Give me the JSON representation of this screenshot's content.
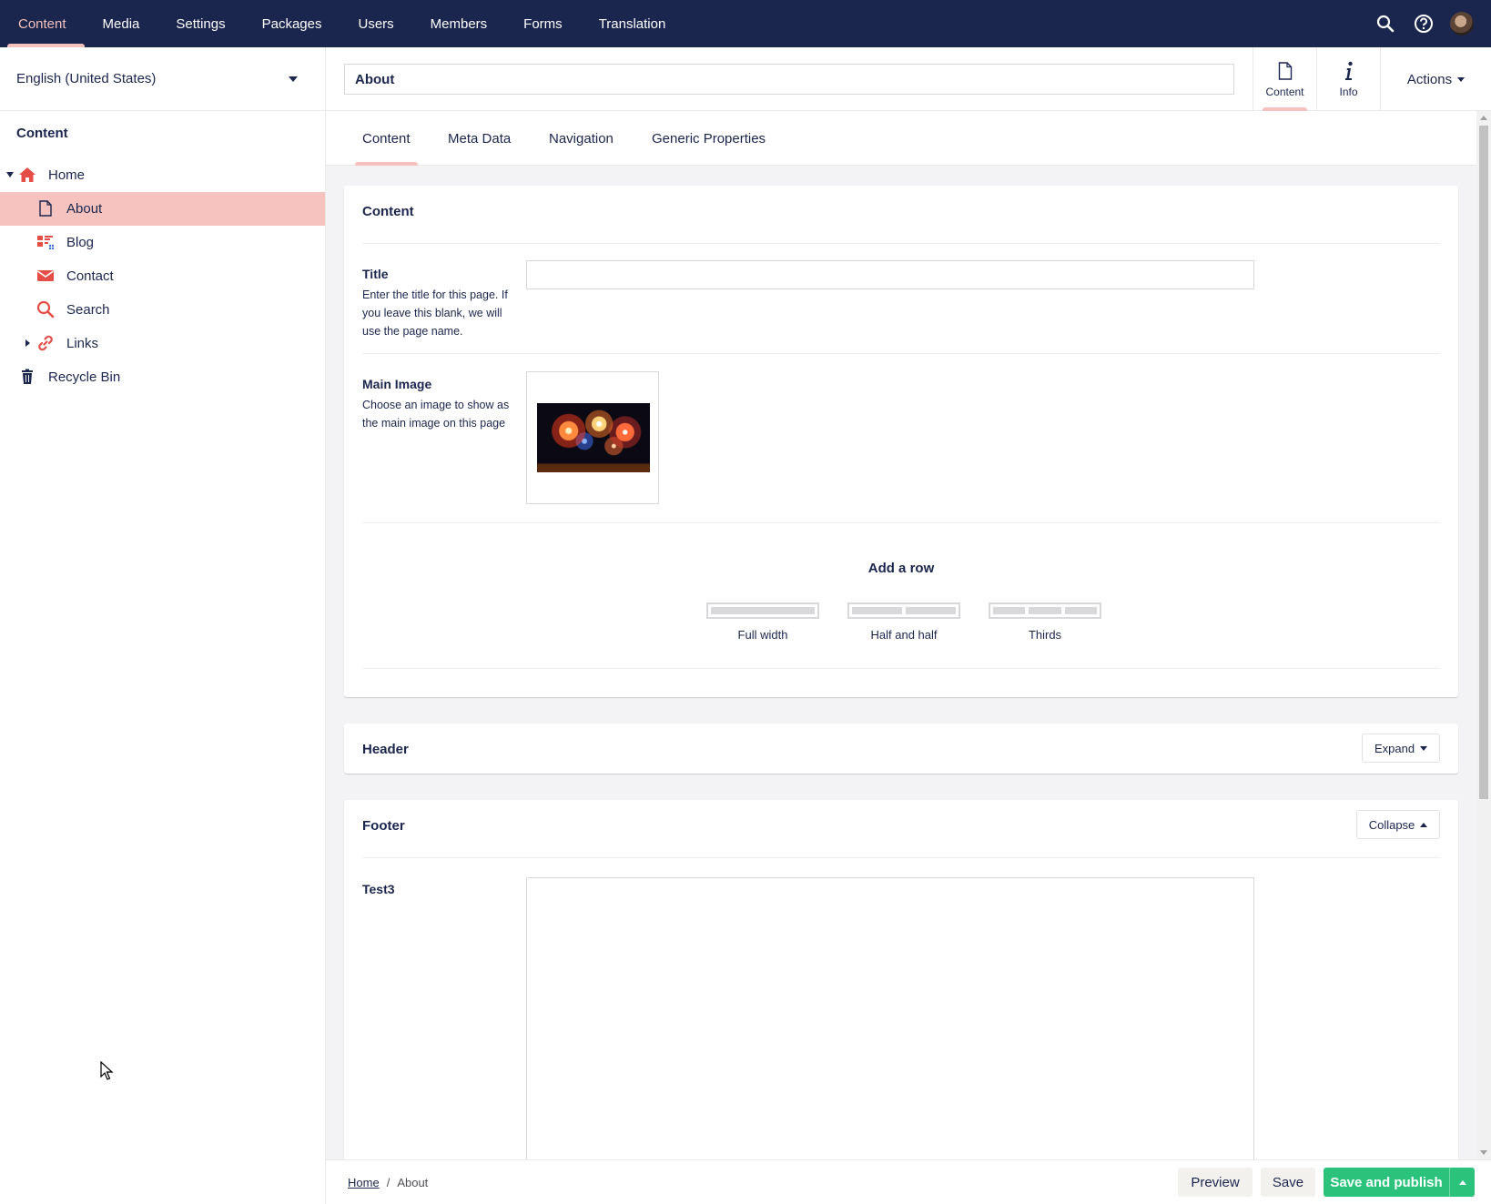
{
  "topnav": {
    "items": [
      {
        "label": "Content",
        "active": true
      },
      {
        "label": "Media"
      },
      {
        "label": "Settings"
      },
      {
        "label": "Packages"
      },
      {
        "label": "Users"
      },
      {
        "label": "Members"
      },
      {
        "label": "Forms"
      },
      {
        "label": "Translation"
      }
    ],
    "icons": [
      "search-icon",
      "help-icon",
      "user-avatar"
    ]
  },
  "sidebar": {
    "culture": "English (United States)",
    "section_title": "Content",
    "tree": [
      {
        "label": "Home",
        "icon": "home-icon",
        "expanded": true
      },
      {
        "label": "About",
        "icon": "document-icon",
        "selected": true
      },
      {
        "label": "Blog",
        "icon": "blog-icon"
      },
      {
        "label": "Contact",
        "icon": "mail-icon"
      },
      {
        "label": "Search",
        "icon": "search-icon"
      },
      {
        "label": "Links",
        "icon": "link-icon",
        "collapsed": true
      },
      {
        "label": "Recycle Bin",
        "icon": "trash-icon"
      }
    ]
  },
  "editor": {
    "node_name": "About",
    "apps": [
      {
        "label": "Content",
        "icon": "document-icon",
        "active": true
      },
      {
        "label": "Info",
        "icon": "info-icon"
      }
    ],
    "actions_label": "Actions",
    "tabs": [
      {
        "label": "Content",
        "active": true
      },
      {
        "label": "Meta Data"
      },
      {
        "label": "Navigation"
      },
      {
        "label": "Generic Properties"
      }
    ]
  },
  "content_panel": {
    "title": "Content",
    "title_prop": {
      "label": "Title",
      "description": "Enter the title for this page. If you leave this blank, we will use the page name.",
      "value": ""
    },
    "image_prop": {
      "label": "Main Image",
      "description": "Choose an image to show as the main image on this page"
    },
    "grid": {
      "add_row": "Add a row",
      "layouts": [
        {
          "label": "Full width",
          "columns": 1
        },
        {
          "label": "Half and half",
          "columns": 2
        },
        {
          "label": "Thirds",
          "columns": 3
        }
      ]
    }
  },
  "header_panel": {
    "title": "Header",
    "toggle_label": "Expand"
  },
  "footer_panel": {
    "title": "Footer",
    "toggle_label": "Collapse",
    "prop_label": "Test3"
  },
  "footer_bar": {
    "breadcrumb": [
      "Home",
      "About"
    ],
    "preview": "Preview",
    "save": "Save",
    "save_publish": "Save and publish"
  },
  "colors": {
    "topbar": "#1b264f",
    "accent_pink": "#f5c1bc",
    "selected_row": "#f6c3be",
    "publish_green": "#2bc37c",
    "icon_red": "#e44e47"
  }
}
